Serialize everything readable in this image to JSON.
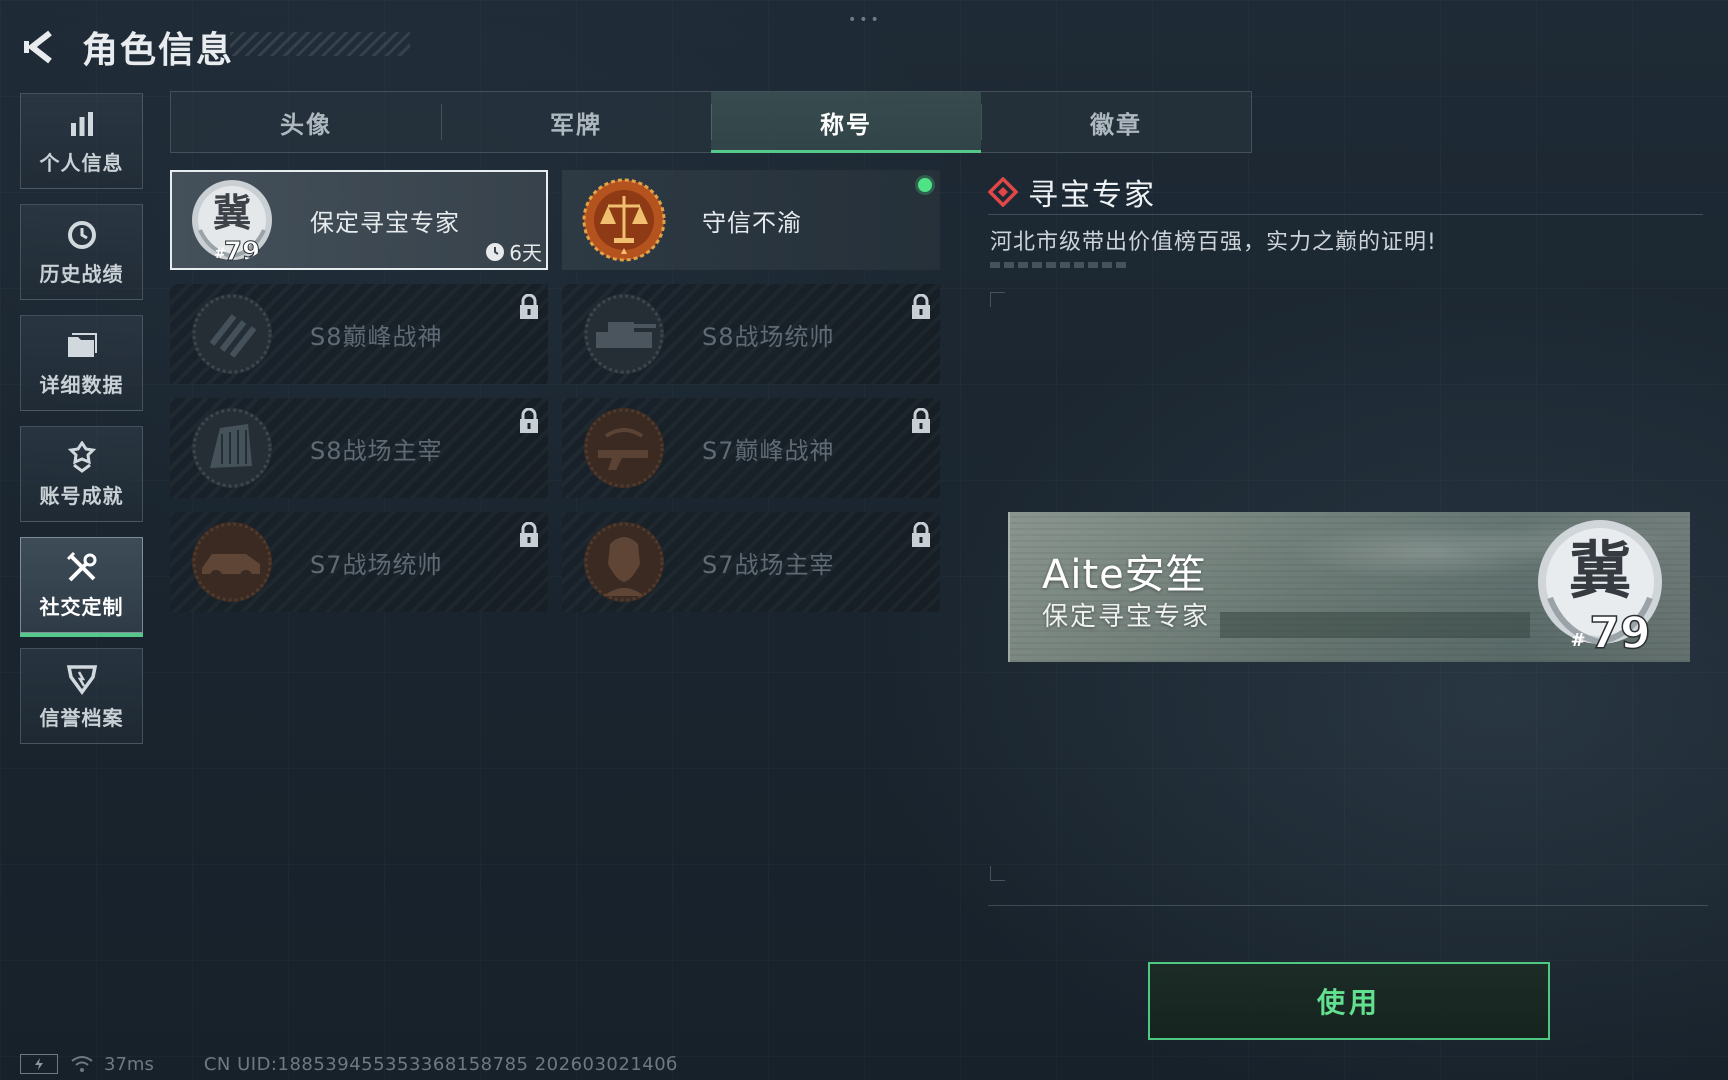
{
  "header": {
    "title": "角色信息"
  },
  "sidebar": {
    "items": [
      {
        "label": "个人信息",
        "icon": "bar-chart-icon"
      },
      {
        "label": "历史战绩",
        "icon": "history-icon"
      },
      {
        "label": "详细数据",
        "icon": "folder-icon"
      },
      {
        "label": "账号成就",
        "icon": "achievement-icon"
      },
      {
        "label": "社交定制",
        "icon": "tools-icon",
        "active": true
      },
      {
        "label": "信誉档案",
        "icon": "shield-icon"
      }
    ]
  },
  "tabs": [
    {
      "label": "头像"
    },
    {
      "label": "军牌"
    },
    {
      "label": "称号",
      "active": true
    },
    {
      "label": "徽章"
    }
  ],
  "titles": [
    {
      "name": "保定寻宝专家",
      "badge_char": "冀",
      "badge_number": "79",
      "timer": "6天",
      "selected": true,
      "locked": false
    },
    {
      "name": "守信不渝",
      "badge_icon": "scales-icon",
      "equipped": true,
      "locked": false
    },
    {
      "name": "S8巅峰战神",
      "locked": true
    },
    {
      "name": "S8战场统帅",
      "locked": true
    },
    {
      "name": "S8战场主宰",
      "locked": true
    },
    {
      "name": "S7巅峰战神",
      "locked": true
    },
    {
      "name": "S7战场统帅",
      "locked": true
    },
    {
      "name": "S7战场主宰",
      "locked": true
    }
  ],
  "detail": {
    "title": "寻宝专家",
    "description": "河北市级带出价值榜百强，实力之巅的证明!"
  },
  "preview": {
    "player_name": "Aite安笙",
    "title": "保定寻宝专家",
    "badge_char": "冀",
    "badge_number": "79"
  },
  "actions": {
    "use_label": "使用"
  },
  "status": {
    "ping": "37ms",
    "uid": "CN UID:18853945535336815878​5 20260302140б"
  },
  "colors": {
    "accent": "#54c98a",
    "equipped": "#4ee486",
    "diamond": "#e04848"
  }
}
